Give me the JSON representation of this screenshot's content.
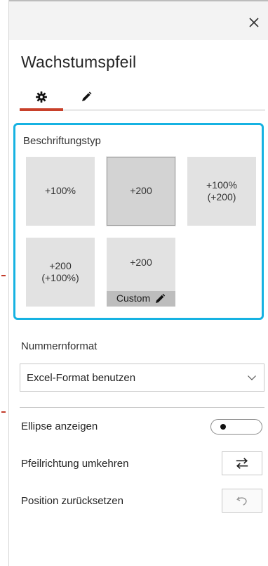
{
  "panel": {
    "title": "Wachstumspfeil",
    "close_icon": "close-icon"
  },
  "tabs": [
    {
      "name": "settings",
      "icon": "gear-icon",
      "active": true
    },
    {
      "name": "style",
      "icon": "pencil-icon",
      "active": false
    }
  ],
  "label_type": {
    "title": "Beschriftungstyp",
    "options": [
      {
        "text": "+100%",
        "selected": false
      },
      {
        "text": "+200",
        "selected": true
      },
      {
        "text": "+100%\n(+200)",
        "selected": false
      },
      {
        "text": "+200\n(+100%)",
        "selected": false
      },
      {
        "text": "+200",
        "selected": false,
        "badge": "Custom",
        "badge_icon": "pencil-icon"
      }
    ]
  },
  "number_format": {
    "label": "Nummernformat",
    "value": "Excel-Format benutzen"
  },
  "rows": {
    "ellipse_label": "Ellipse anzeigen",
    "ellipse_on": false,
    "reverse_label": "Pfeilrichtung umkehren",
    "reverse_icon": "swap-arrows-icon",
    "reset_label": "Position zurücksetzen",
    "reset_icon": "undo-icon"
  },
  "colors": {
    "accent_red": "#c8402a",
    "focus_blue": "#16b2e2"
  }
}
